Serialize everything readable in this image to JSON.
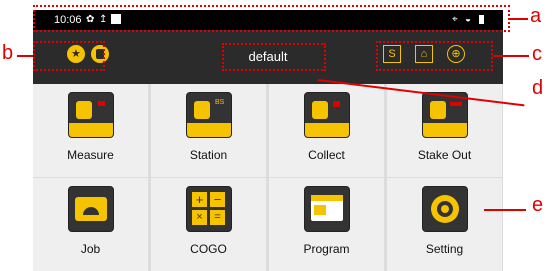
{
  "status_bar": {
    "time": "10:06"
  },
  "app_bar": {
    "title": "default",
    "right_s_label": "S"
  },
  "tiles": [
    {
      "label": "Measure"
    },
    {
      "label": "Station"
    },
    {
      "label": "Collect"
    },
    {
      "label": "Stake Out"
    },
    {
      "label": "Job"
    },
    {
      "label": "COGO"
    },
    {
      "label": "Program"
    },
    {
      "label": "Setting"
    }
  ],
  "annotations": {
    "a": "a",
    "b": "b",
    "c": "c",
    "d": "d",
    "e": "e"
  },
  "colors": {
    "accent": "#f5c300",
    "annotation": "#e00000",
    "bar": "#2b2b2b"
  },
  "icons": [
    "settings-gear-icon",
    "upload-icon",
    "location-icon",
    "wifi-icon",
    "battery-icon",
    "star-icon",
    "database-icon",
    "home-icon",
    "target-icon"
  ]
}
